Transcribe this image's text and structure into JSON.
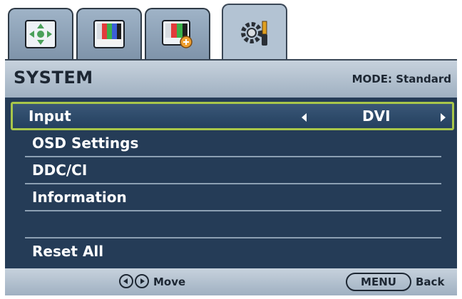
{
  "tabs": [
    {
      "icon": "display-adjust-icon",
      "active": false
    },
    {
      "icon": "picture-icon",
      "active": false
    },
    {
      "icon": "picture-advanced-icon",
      "active": false
    },
    {
      "icon": "system-settings-icon",
      "active": true
    }
  ],
  "header": {
    "title": "SYSTEM",
    "mode": "MODE: Standard"
  },
  "menu": {
    "items": [
      {
        "label": "Input",
        "value": "DVI",
        "selected": true
      },
      {
        "label": "OSD Settings"
      },
      {
        "label": "DDC/CI"
      },
      {
        "label": "Information"
      },
      {
        "label": ""
      },
      {
        "label": "Reset All"
      }
    ]
  },
  "footer": {
    "move_label": "Move",
    "menu_label": "MENU",
    "back_label": "Back"
  },
  "colors": {
    "panel_bg": "#253c57",
    "selection_border": "#a8c64a",
    "header_bg": "#b3c3d3"
  }
}
